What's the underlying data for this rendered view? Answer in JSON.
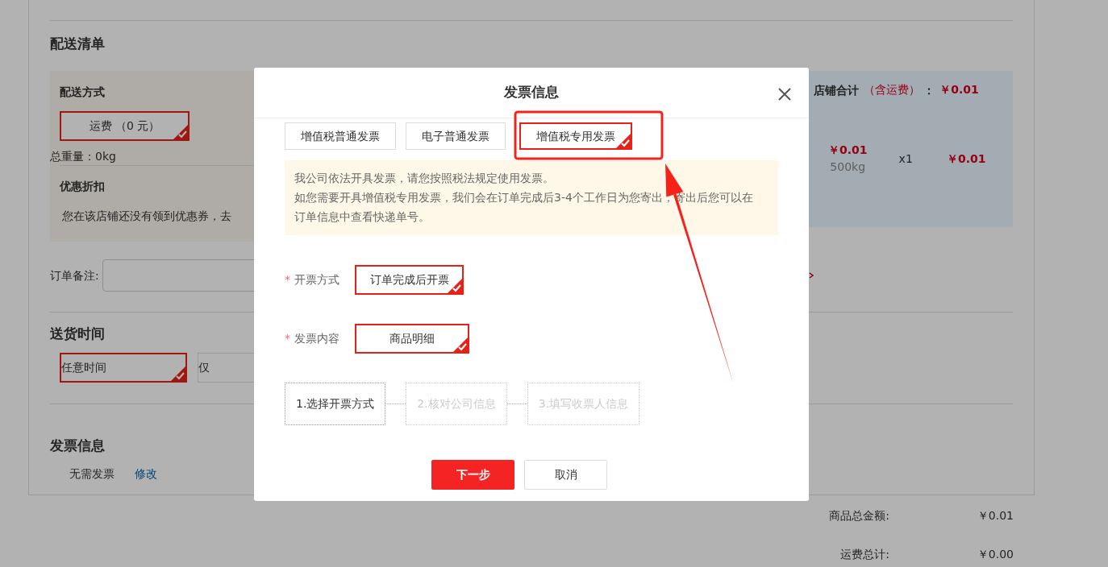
{
  "page": {
    "section_title": "配送清单",
    "shipping": {
      "label": "配送方式",
      "options": [
        {
          "label": "运费 （0 元）",
          "selected": true
        }
      ],
      "weight": "总重量：0kg"
    },
    "discount": {
      "label": "优惠折扣",
      "text": "您在该店铺还没有领到优惠券，去"
    },
    "store_total": {
      "label": "店铺合计",
      "note": "（含运费）",
      "colon": "：",
      "amount": "￥0.01"
    },
    "item": {
      "price": "￥0.01",
      "weight": "500kg",
      "quantity": "x1",
      "subtotal": "￥0.01"
    },
    "order_note": {
      "label": "订单备注:"
    },
    "delivery_time": {
      "title": "送货时间",
      "options": [
        {
          "label": "任意时间",
          "selected": true
        },
        {
          "label": "仅",
          "selected": false
        }
      ]
    },
    "invoice": {
      "title": "发票信息",
      "value": "无需发票",
      "edit_link": "修改"
    },
    "summary": [
      {
        "label": "商品总金额:",
        "value": "￥0.01"
      },
      {
        "label": "运费总计:",
        "value": "￥0.00"
      }
    ]
  },
  "dialog": {
    "title": "发票信息",
    "tabs": [
      {
        "label": "增值税普通发票",
        "selected": false
      },
      {
        "label": "电子普通发票",
        "selected": false
      },
      {
        "label": "增值税专用发票",
        "selected": true
      }
    ],
    "notice": [
      "我公司依法开具发票，请您按照税法规定使用发票。",
      "如您需要开具增值税专用发票，我们会在订单完成后3-4个工作日为您寄出，寄出后您可以在订单信息中查看快递单号。"
    ],
    "fields": [
      {
        "label": "开票方式",
        "required_mark": "*",
        "options": [
          {
            "label": "订单完成后开票",
            "selected": true
          }
        ]
      },
      {
        "label": "发票内容",
        "required_mark": "*",
        "options": [
          {
            "label": "商品明细",
            "selected": true
          }
        ]
      }
    ],
    "steps": [
      {
        "label": "1.选择开票方式",
        "active": true
      },
      {
        "label": "2.核对公司信息",
        "active": false
      },
      {
        "label": "3.填写收票人信息",
        "active": false
      }
    ],
    "buttons": [
      {
        "label": "下一步",
        "kind": "primary"
      },
      {
        "label": "取消",
        "kind": "secondary"
      }
    ]
  },
  "annotations": [
    {
      "kind": "box"
    },
    {
      "kind": "arrow"
    }
  ]
}
